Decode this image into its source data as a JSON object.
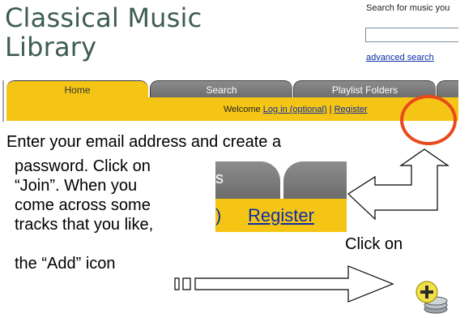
{
  "site": {
    "title_line1": "Classical Music",
    "title_line2": "Library",
    "search_prompt": "Search  for music you",
    "search_input_value": "",
    "advanced_search": "advanced search",
    "tabs": [
      {
        "label": "Home",
        "active": true
      },
      {
        "label": "Search",
        "active": false
      },
      {
        "label": "Playlist Folders",
        "active": false
      },
      {
        "label": "",
        "active": false
      }
    ],
    "welcome_text": "Welcome",
    "login_link": "Log in (optional)",
    "separator": "|",
    "register_link": "Register"
  },
  "instructions": {
    "line1": "Enter your email  address and create a",
    "line2": "password. Click on",
    "line3": "“Join”.  When you",
    "line4": "come across some",
    "line5": "tracks that you like,",
    "click_on": "Click on",
    "line7": "the “Add” icon"
  },
  "inset": {
    "tab_fragment": "s",
    "paren": ")",
    "register": "Register"
  },
  "colors": {
    "title": "#3d5c55",
    "tab_yellow": "#f5c516",
    "tab_gray": "#7a7a7a",
    "link_blue": "#0b2ea8",
    "highlight_red": "#e84a1c"
  },
  "icons": {
    "add_icon": "add-to-playlist-icon"
  }
}
